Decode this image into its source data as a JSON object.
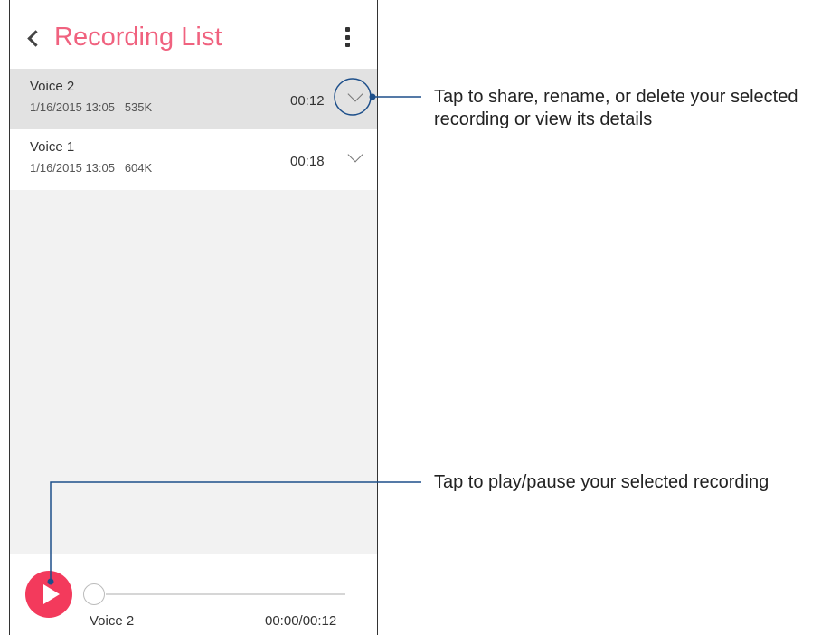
{
  "header": {
    "title": "Recording List"
  },
  "recordings": [
    {
      "name": "Voice 2",
      "date": "1/16/2015 13:05",
      "size": "535K",
      "duration": "00:12"
    },
    {
      "name": "Voice 1",
      "date": "1/16/2015 13:05",
      "size": "604K",
      "duration": "00:18"
    }
  ],
  "player": {
    "track_name": "Voice 2",
    "time": "00:00/00:12",
    "progress": 0
  },
  "annotations": {
    "options_line1": "Tap to share, rename, or delete your selected",
    "options_line2": "recording or view its details",
    "play": "Tap to play/pause your selected recording"
  },
  "colors": {
    "accent": "#f0627f",
    "play_button": "#f33a5c",
    "callout_line": "#1d4f8a"
  }
}
